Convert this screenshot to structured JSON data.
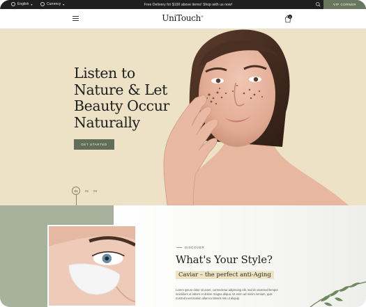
{
  "topbar": {
    "language": "English",
    "currency": "Currency",
    "promo": "Free Delivery for $100 above items! Shop with us now!",
    "vip": "VIP CORNER",
    "icons": [
      "globe-icon",
      "currency-icon",
      "chevron-down-icon",
      "search-icon"
    ]
  },
  "header": {
    "logo": "UniTouch",
    "logo_mark": "®",
    "cart_count": "0",
    "icons": [
      "menu-icon",
      "shopping-bag-icon"
    ]
  },
  "hero": {
    "title_lines": [
      "Listen to",
      "Nature & Let",
      "Beauty Occur",
      "Naturally"
    ],
    "cta": "GET STARTED",
    "slides": [
      "01",
      "02",
      "03"
    ],
    "background_color": "#ede2c5",
    "cta_color": "#5f6e55"
  },
  "feature": {
    "eyebrow": "DISCOVER",
    "title": "What's Your Style?",
    "highlight": "Caviar – the perfect anti-Aging",
    "paragraph": "Lorem ipsum dolor sit amet, consectetur adipiscing elit, sed do eiusmod tempor incididunt ut labore et dolore magna aliqua. Ut enim ad minim veniam, quis nostrud exercitation ullamco laboris nisi ut aliquip.",
    "accent_color": "#a7b29c",
    "highlight_color": "#efe4c2"
  }
}
